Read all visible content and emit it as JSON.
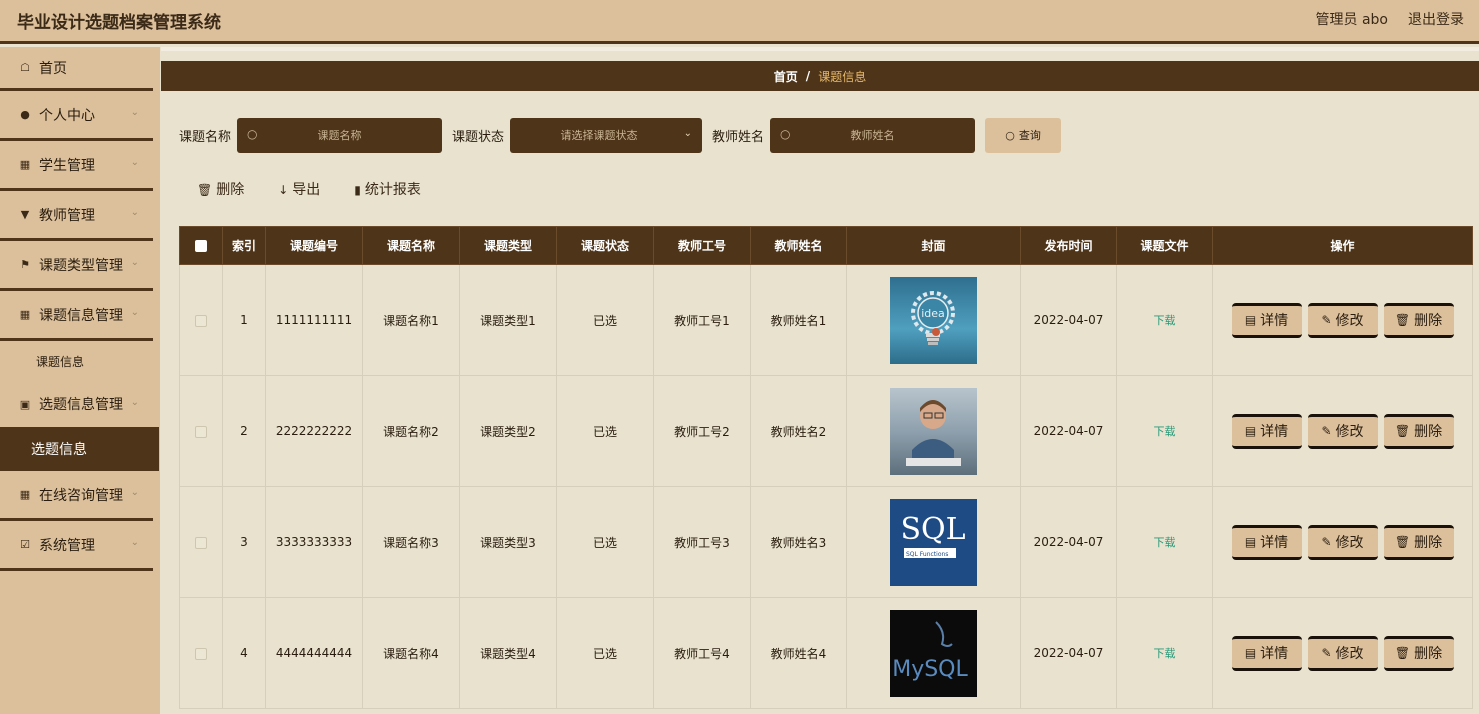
{
  "app": {
    "title": "毕业设计选题档案管理系统",
    "user_label": "管理员 abo",
    "logout_label": "退出登录"
  },
  "sidebar": {
    "items": [
      {
        "label": "首页",
        "icon": "home-icon",
        "has_chevron": false
      },
      {
        "label": "个人中心",
        "icon": "user-icon",
        "has_chevron": true
      },
      {
        "label": "学生管理",
        "icon": "grid-icon",
        "has_chevron": true
      },
      {
        "label": "教师管理",
        "icon": "cup-icon",
        "has_chevron": true
      },
      {
        "label": "课题类型管理",
        "icon": "flag-icon",
        "has_chevron": true
      },
      {
        "label": "课题信息管理",
        "icon": "grid-icon",
        "has_chevron": true
      },
      {
        "label": "课题信息",
        "sub": true
      },
      {
        "label": "选题信息管理",
        "icon": "briefcase-icon",
        "has_chevron": true
      },
      {
        "label": "选题信息",
        "sub": true,
        "active": true
      },
      {
        "label": "在线咨询管理",
        "icon": "grid-icon",
        "has_chevron": true
      },
      {
        "label": "系统管理",
        "icon": "check-icon",
        "has_chevron": true
      }
    ]
  },
  "breadcrumb": {
    "home": "首页",
    "separator": "/",
    "current": "课题信息"
  },
  "search": {
    "topic_name_label": "课题名称",
    "topic_name_placeholder": "课题名称",
    "topic_status_label": "课题状态",
    "topic_status_placeholder": "请选择课题状态",
    "teacher_name_label": "教师姓名",
    "teacher_name_placeholder": "教师姓名",
    "query_label": "查询"
  },
  "actions": {
    "delete_label": "删除",
    "export_label": "导出",
    "report_label": "统计报表"
  },
  "table": {
    "headers": [
      "索引",
      "课题编号",
      "课题名称",
      "课题类型",
      "课题状态",
      "教师工号",
      "教师姓名",
      "封面",
      "发布时间",
      "课题文件",
      "操作"
    ],
    "rows": [
      {
        "index": "1",
        "code": "1111111111",
        "name": "课题名称1",
        "type": "课题类型1",
        "status": "已选",
        "teacher_no": "教师工号1",
        "teacher_name": "教师姓名1",
        "cover": "idea",
        "cover_text": "idea",
        "date": "2022-04-07",
        "file": "下载"
      },
      {
        "index": "2",
        "code": "2222222222",
        "name": "课题名称2",
        "type": "课题类型2",
        "status": "已选",
        "teacher_no": "教师工号2",
        "teacher_name": "教师姓名2",
        "cover": "kid",
        "cover_text": "",
        "date": "2022-04-07",
        "file": "下载"
      },
      {
        "index": "3",
        "code": "3333333333",
        "name": "课题名称3",
        "type": "课题类型3",
        "status": "已选",
        "teacher_no": "教师工号3",
        "teacher_name": "教师姓名3",
        "cover": "sql",
        "cover_text": "SQL",
        "cover_subtext": "SQL Functions",
        "date": "2022-04-07",
        "file": "下载"
      },
      {
        "index": "4",
        "code": "4444444444",
        "name": "课题名称4",
        "type": "课题类型4",
        "status": "已选",
        "teacher_no": "教师工号4",
        "teacher_name": "教师姓名4",
        "cover": "mysql",
        "cover_text": "MySQL",
        "date": "2022-04-07",
        "file": "下载"
      }
    ],
    "row_actions": {
      "detail_label": "详情",
      "edit_label": "修改",
      "delete_label": "删除"
    }
  },
  "colors": {
    "header_bg": "#dcc09c",
    "dark_brown": "#4e3419",
    "page_bg": "#e8e2cf",
    "breadcrumb_current": "#e6b86a",
    "download_link": "#2a9a7a"
  }
}
